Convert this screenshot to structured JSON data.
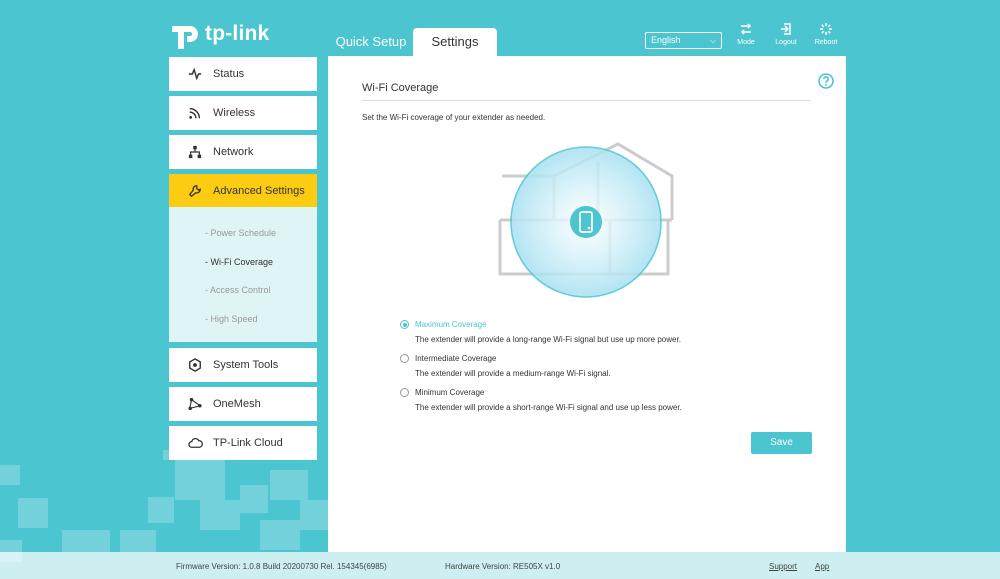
{
  "brand": {
    "name": "tp-link"
  },
  "header": {
    "tabs": [
      {
        "label": "Quick Setup"
      },
      {
        "label": "Settings"
      }
    ],
    "language": {
      "selected": "English"
    },
    "buttons": {
      "mode": "Mode",
      "logout": "Logout",
      "reboot": "Reboot"
    }
  },
  "sidebar": {
    "items": [
      {
        "label": "Status",
        "icon": "pulse-icon"
      },
      {
        "label": "Wireless",
        "icon": "wifi-icon"
      },
      {
        "label": "Network",
        "icon": "network-icon"
      },
      {
        "label": "Advanced Settings",
        "icon": "wrench-icon"
      },
      {
        "label": "System Tools",
        "icon": "gear-icon"
      },
      {
        "label": "OneMesh",
        "icon": "mesh-icon"
      },
      {
        "label": "TP-Link Cloud",
        "icon": "cloud-icon"
      }
    ],
    "submenu": [
      "- Power Schedule",
      "- Wi-Fi Coverage",
      "- Access Control",
      "- High Speed"
    ]
  },
  "main": {
    "title": "Wi-Fi Coverage",
    "description": "Set the Wi-Fi coverage of your extender as needed.",
    "options": [
      {
        "label": "Maximum Coverage",
        "desc": "The extender will provide a long-range Wi-Fi signal but use up more power.",
        "selected": true
      },
      {
        "label": "Intermediate Coverage",
        "desc": "The extender will provide a medium-range Wi-Fi signal.",
        "selected": false
      },
      {
        "label": "Minimum Coverage",
        "desc": "The extender will provide a short-range Wi-Fi signal and use up less power.",
        "selected": false
      }
    ],
    "save_label": "Save"
  },
  "footer": {
    "firmware": "Firmware Version: 1.0.8 Build 20200730 Rel. 154345(6985)",
    "hardware": "Hardware Version: RE505X v1.0",
    "support": "Support",
    "app": "App"
  },
  "colors": {
    "accent": "#4bc5d0",
    "active_nav": "#fccc13"
  }
}
